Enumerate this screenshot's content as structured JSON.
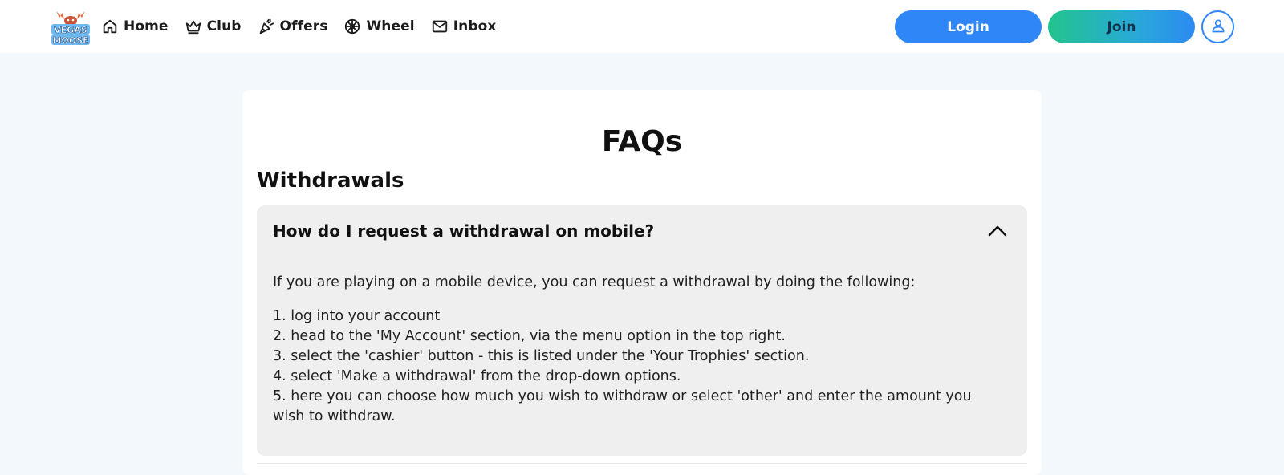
{
  "brand": {
    "logo_text_line1": "VEGAS",
    "logo_text_line2": "MOOSE"
  },
  "nav": {
    "items": [
      {
        "label": "Home",
        "icon": "home-icon"
      },
      {
        "label": "Club",
        "icon": "crown-icon"
      },
      {
        "label": "Offers",
        "icon": "party-popper-icon"
      },
      {
        "label": "Wheel",
        "icon": "wheel-icon"
      },
      {
        "label": "Inbox",
        "icon": "mail-icon"
      }
    ]
  },
  "header": {
    "login_label": "Login",
    "join_label": "Join",
    "profile_icon": "user-icon"
  },
  "page": {
    "title": "FAQs",
    "section_title": "Withdrawals"
  },
  "faq": {
    "question": "How do I request a withdrawal on mobile?",
    "expanded": true,
    "intro": "If you are playing on a mobile device, you can request a withdrawal by doing the following:",
    "steps": [
      "1. log into your account",
      "2. head to the 'My Account' section, via the menu option in the top right.",
      "3. select the 'cashier' button - this is listed under the 'Your Trophies' section.",
      "4. select 'Make a withdrawal' from the drop-down options.",
      "5. here you can choose how much you wish to withdraw or select 'other' and enter the amount you wish to withdraw."
    ]
  },
  "colors": {
    "accent_blue": "#2f86f6",
    "join_green": "#22c48e",
    "page_bg": "#f3f8fc",
    "faq_bg": "#efefef"
  }
}
